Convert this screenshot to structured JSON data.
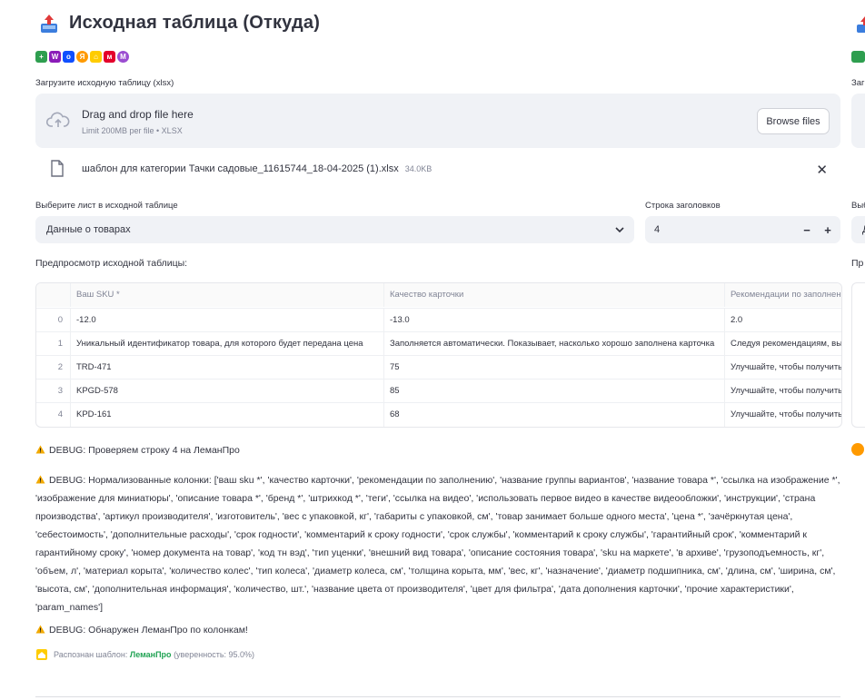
{
  "page": {
    "title": "Исходная таблица (Откуда)",
    "title_icon": "inbox-tray-icon"
  },
  "marketplaces": [
    {
      "name": "plus-icon",
      "color": "#2e9e4f",
      "glyph": "+"
    },
    {
      "name": "w-icon",
      "color": "#8a1bb8",
      "glyph": "W"
    },
    {
      "name": "ozon-icon",
      "color": "#0f4fff",
      "glyph": "o"
    },
    {
      "name": "yandex-icon",
      "color": "#ff9a00",
      "glyph": "Я"
    },
    {
      "name": "lemanpro-icon",
      "color": "#ffcc00",
      "glyph": "⌂"
    },
    {
      "name": "mvideo-icon",
      "color": "#e4002b",
      "glyph": "м"
    },
    {
      "name": "megamarket-icon",
      "color": "#9b4dd1",
      "glyph": "M"
    }
  ],
  "upload": {
    "label": "Загрузите исходную таблицу (xlsx)",
    "drop_text": "Drag and drop file here",
    "limit_text": "Limit 200MB per file • XLSX",
    "browse_label": "Browse files",
    "file_name": "шаблон для категории Тачки садовые_11615744_18-04-2025 (1).xlsx",
    "file_size": "34.0KB"
  },
  "sheet_select": {
    "label": "Выберите лист в исходной таблице",
    "value": "Данные о товарах"
  },
  "header_row": {
    "label": "Строка заголовков",
    "value": "4",
    "minus": "−",
    "plus": "+"
  },
  "preview": {
    "label": "Предпросмотр исходной таблицы:",
    "columns": [
      "",
      "Ваш SKU *",
      "Качество карточки",
      "Рекомендации по заполнению"
    ],
    "rows": [
      [
        "0",
        "-12.0",
        "-13.0",
        "2.0"
      ],
      [
        "1",
        "Уникальный идентификатор товара, для которого будет передана цена",
        "Заполняется автоматически. Показывает, насколько хорошо заполнена карточка",
        "Следуя рекомендациям, вы"
      ],
      [
        "2",
        "TRD-471",
        "75",
        "Улучшайте, чтобы получить"
      ],
      [
        "3",
        "KPGD-578",
        "85",
        "Улучшайте, чтобы получить"
      ],
      [
        "4",
        "KPD-161",
        "68",
        "Улучшайте, чтобы получить"
      ]
    ]
  },
  "debug": {
    "line1": "DEBUG: Проверяем строку 4 на ЛеманПро",
    "line2": "DEBUG: Нормализованные колонки: ['ваш sku *', 'качество карточки', 'рекомендации по заполнению', 'название группы вариантов', 'название товара *', 'ссылка на изображение *', 'изображение для миниатюры', 'описание товара *', 'бренд *', 'штрихкод *', 'теги', 'ссылка на видео', 'использовать первое видео в качестве видеообложки', 'инструкции', 'страна производства', 'артикул производителя', 'изготовитель', 'вес с упаковкой, кг', 'габариты с упаковкой, см', 'товар занимает больше одного места', 'цена *', 'зачёркнутая цена', 'себестоимость', 'дополнительные расходы', 'срок годности', 'комментарий к сроку годности', 'срок службы', 'комментарий к сроку службы', 'гарантийный срок', 'комментарий к гарантийному сроку', 'номер документа на товар', 'код тн вэд', 'тип уценки', 'внешний вид товара', 'описание состояния товара', 'sku на маркете', 'в архиве', 'грузоподъемность, кг', 'объем, л', 'материал корыта', 'количество колес', 'тип колеса', 'диаметр колеса, см', 'толщина корыта, мм', 'вес, кг', 'назначение', 'диаметр подшипника, см', 'длина, см', 'ширина, см', 'высота, см', 'дополнительная информация', 'количество, шт.', 'название цвета от производителя', 'цвет для фильтра', 'дата дополнения карточки', 'прочие характеристики', 'param_names']",
    "line3": "DEBUG: Обнаружен ЛеманПро по колонкам!"
  },
  "detected": {
    "prefix": "Распознан шаблон:",
    "template": "ЛеманПро",
    "confidence": "(уверенность: 95.0%)"
  },
  "right_column_ghost": {
    "label1": "Заг",
    "label2": "Выб",
    "value2": "Д",
    "label3": "Пр"
  },
  "colors": {
    "warning": "#f2a900",
    "success": "#21a354",
    "input_bg": "#f0f2f6"
  }
}
